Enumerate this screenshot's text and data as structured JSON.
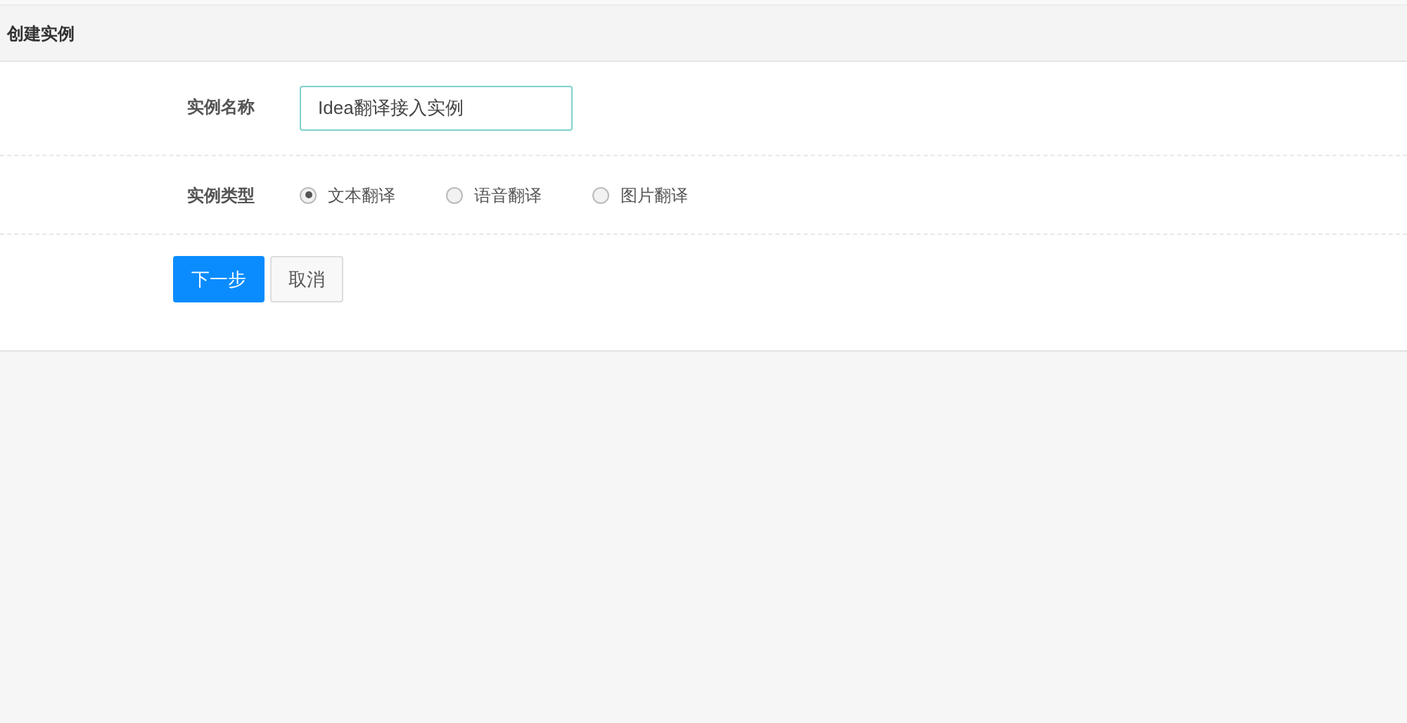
{
  "header": {
    "title": "创建实例"
  },
  "name_field": {
    "label": "实例名称",
    "value": "Idea翻译接入实例"
  },
  "type_field": {
    "label": "实例类型",
    "options": [
      {
        "label": "文本翻译",
        "selected": true
      },
      {
        "label": "语音翻译",
        "selected": false
      },
      {
        "label": "图片翻译",
        "selected": false
      }
    ]
  },
  "buttons": [
    {
      "label": "下一步",
      "kind": "primary"
    },
    {
      "label": "取消",
      "kind": "default"
    }
  ]
}
